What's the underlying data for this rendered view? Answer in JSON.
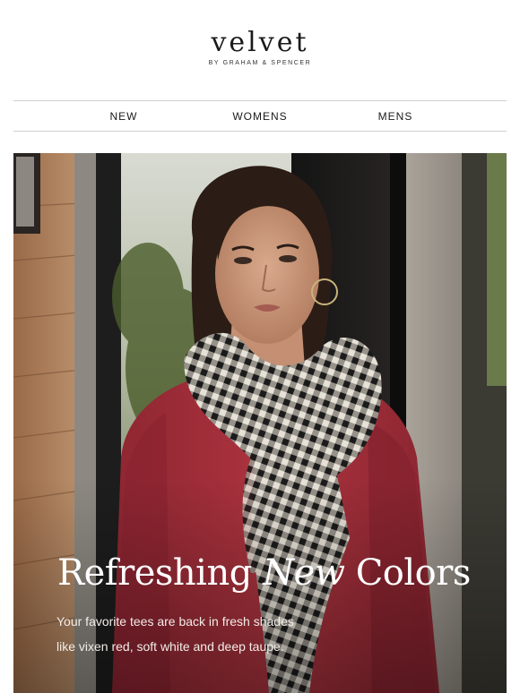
{
  "brand": {
    "name": "velvet",
    "tagline": "BY GRAHAM & SPENCER"
  },
  "nav": {
    "items": [
      {
        "label": "NEW"
      },
      {
        "label": "WOMENS"
      },
      {
        "label": "MENS"
      }
    ]
  },
  "hero": {
    "title_part1": "Refreshing",
    "title_part2": "New",
    "title_part3": "Colors",
    "body_line1": "Your favorite tees are back in fresh shades",
    "body_line2": "like vixen red, soft white and deep taupe."
  },
  "colors": {
    "tee_red": "#a8303b",
    "scarf_black": "#1b1b1b",
    "scarf_cream": "#e7e2d7"
  }
}
